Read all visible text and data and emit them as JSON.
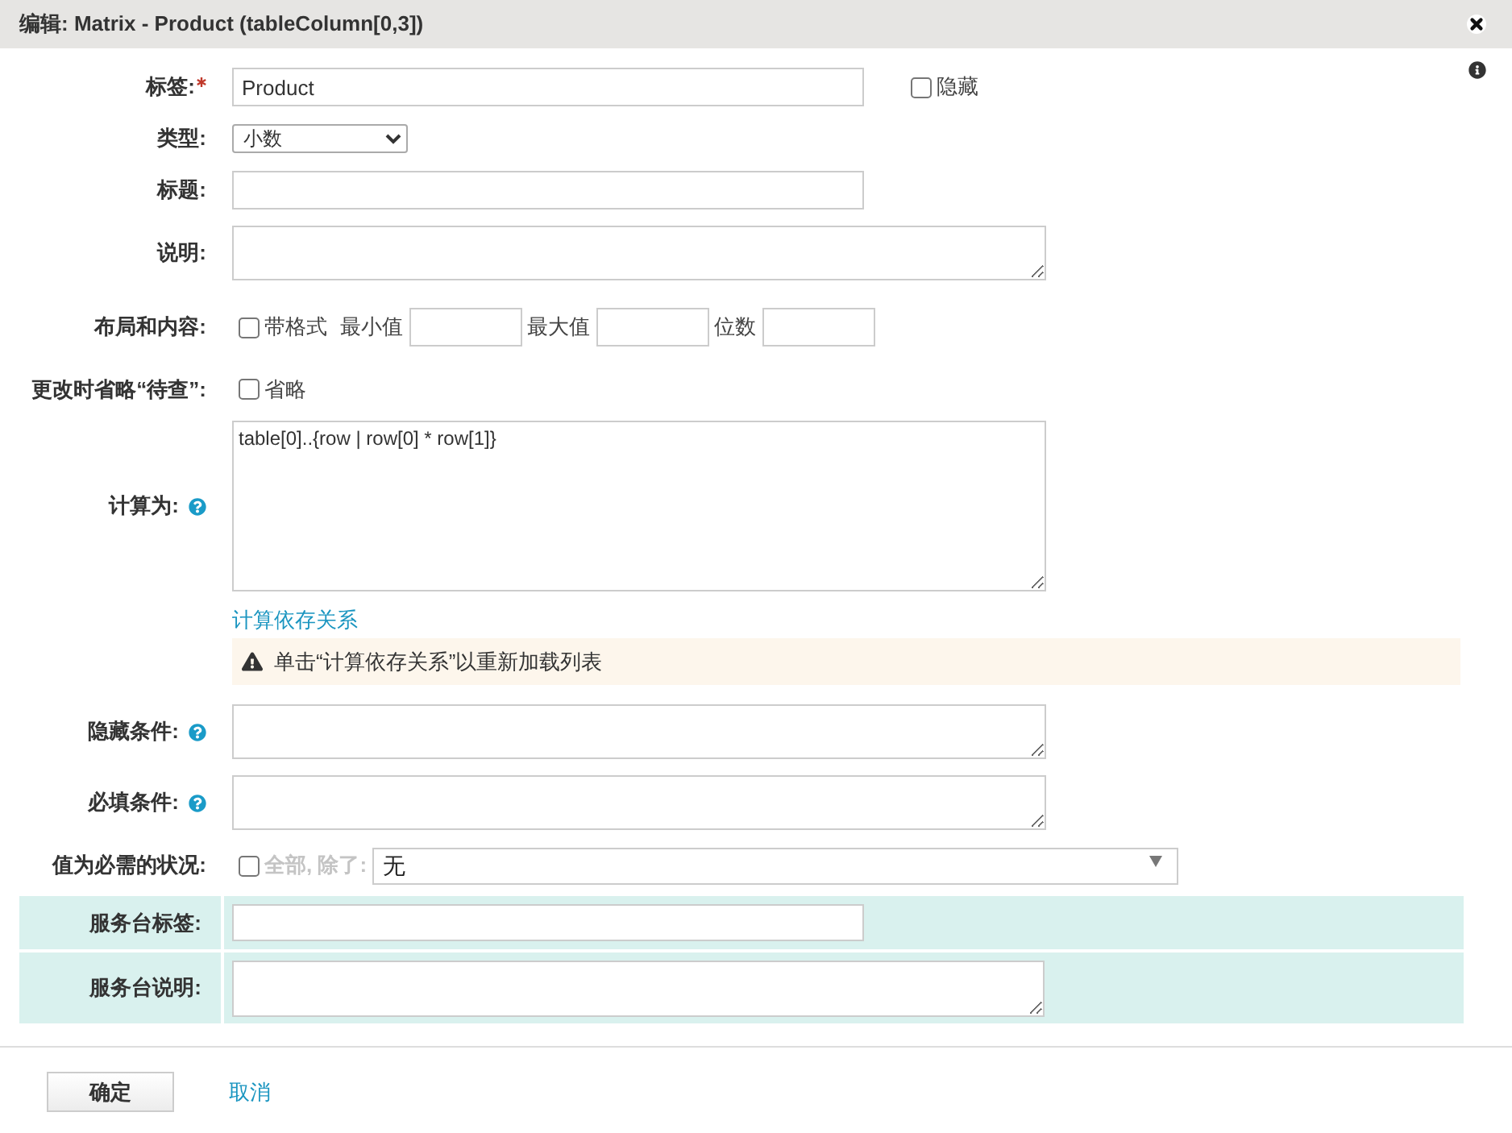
{
  "dialog": {
    "title": "编辑: Matrix - Product (tableColumn[0,3])"
  },
  "fields": [
    {
      "kind": "text",
      "label": "标签:",
      "required": true,
      "help": false,
      "value": "Product",
      "side_checkbox": {
        "label": "隐藏",
        "checked": false
      }
    },
    {
      "kind": "select",
      "label": "类型:",
      "required": false,
      "help": false,
      "value": "小数"
    },
    {
      "kind": "text",
      "label": "标题:",
      "required": false,
      "help": false
    },
    {
      "kind": "textarea",
      "label": "说明:",
      "required": false,
      "help": false
    },
    {
      "kind": "layout",
      "label": "布局和内容:",
      "required": false,
      "help": false,
      "checkbox": {
        "label": "带格式",
        "checked": false
      },
      "inputs": [
        {
          "label": "最小值"
        },
        {
          "label": "最大值"
        },
        {
          "label": "位数"
        }
      ]
    },
    {
      "kind": "checkbox",
      "label": "更改时省略“待查”:",
      "required": false,
      "help": false,
      "checkbox": {
        "label": "省略",
        "checked": false
      }
    },
    {
      "kind": "code",
      "label": "计算为:",
      "required": false,
      "help": true,
      "value": "table[0]..{row | row[0] * row[1]}",
      "link": "计算依存关系",
      "notice": "单击“计算依存关系”以重新加载列表"
    },
    {
      "kind": "textarea",
      "label": "隐藏条件:",
      "required": false,
      "help": true
    },
    {
      "kind": "textarea",
      "label": "必填条件:",
      "required": false,
      "help": true
    },
    {
      "kind": "exception",
      "label": "值为必需的状况:",
      "required": false,
      "help": false,
      "checkbox": {
        "label": "全部, 除了:",
        "checked": false,
        "disabled": true
      },
      "value": "无"
    }
  ],
  "service_desk": [
    {
      "kind": "text",
      "label": "服务台标签:"
    },
    {
      "kind": "textarea",
      "label": "服务台说明:"
    }
  ],
  "buttons": [
    {
      "kind": "primary",
      "label": "确定"
    },
    {
      "kind": "link",
      "label": "取消"
    }
  ]
}
